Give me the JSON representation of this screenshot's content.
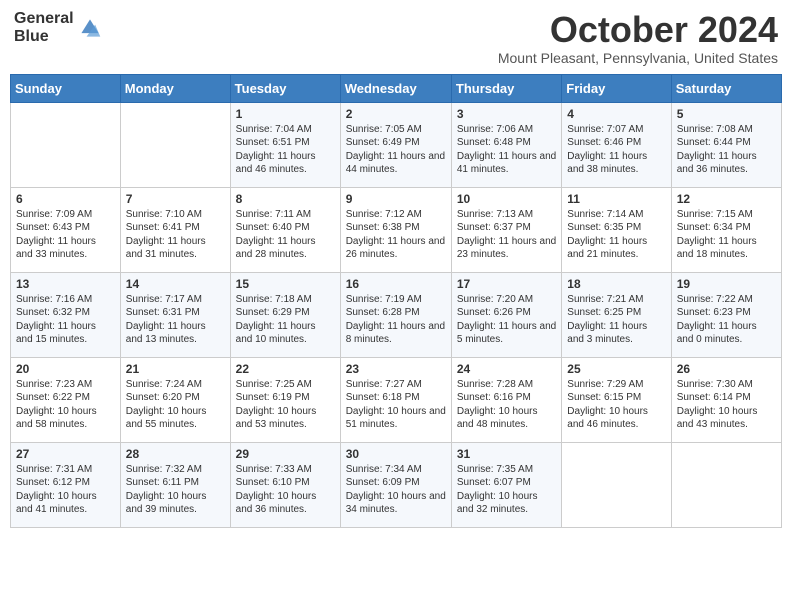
{
  "header": {
    "logo_line1": "General",
    "logo_line2": "Blue",
    "title": "October 2024",
    "subtitle": "Mount Pleasant, Pennsylvania, United States"
  },
  "weekdays": [
    "Sunday",
    "Monday",
    "Tuesday",
    "Wednesday",
    "Thursday",
    "Friday",
    "Saturday"
  ],
  "weeks": [
    [
      {
        "day": "",
        "content": ""
      },
      {
        "day": "",
        "content": ""
      },
      {
        "day": "1",
        "content": "Sunrise: 7:04 AM\nSunset: 6:51 PM\nDaylight: 11 hours and 46 minutes."
      },
      {
        "day": "2",
        "content": "Sunrise: 7:05 AM\nSunset: 6:49 PM\nDaylight: 11 hours and 44 minutes."
      },
      {
        "day": "3",
        "content": "Sunrise: 7:06 AM\nSunset: 6:48 PM\nDaylight: 11 hours and 41 minutes."
      },
      {
        "day": "4",
        "content": "Sunrise: 7:07 AM\nSunset: 6:46 PM\nDaylight: 11 hours and 38 minutes."
      },
      {
        "day": "5",
        "content": "Sunrise: 7:08 AM\nSunset: 6:44 PM\nDaylight: 11 hours and 36 minutes."
      }
    ],
    [
      {
        "day": "6",
        "content": "Sunrise: 7:09 AM\nSunset: 6:43 PM\nDaylight: 11 hours and 33 minutes."
      },
      {
        "day": "7",
        "content": "Sunrise: 7:10 AM\nSunset: 6:41 PM\nDaylight: 11 hours and 31 minutes."
      },
      {
        "day": "8",
        "content": "Sunrise: 7:11 AM\nSunset: 6:40 PM\nDaylight: 11 hours and 28 minutes."
      },
      {
        "day": "9",
        "content": "Sunrise: 7:12 AM\nSunset: 6:38 PM\nDaylight: 11 hours and 26 minutes."
      },
      {
        "day": "10",
        "content": "Sunrise: 7:13 AM\nSunset: 6:37 PM\nDaylight: 11 hours and 23 minutes."
      },
      {
        "day": "11",
        "content": "Sunrise: 7:14 AM\nSunset: 6:35 PM\nDaylight: 11 hours and 21 minutes."
      },
      {
        "day": "12",
        "content": "Sunrise: 7:15 AM\nSunset: 6:34 PM\nDaylight: 11 hours and 18 minutes."
      }
    ],
    [
      {
        "day": "13",
        "content": "Sunrise: 7:16 AM\nSunset: 6:32 PM\nDaylight: 11 hours and 15 minutes."
      },
      {
        "day": "14",
        "content": "Sunrise: 7:17 AM\nSunset: 6:31 PM\nDaylight: 11 hours and 13 minutes."
      },
      {
        "day": "15",
        "content": "Sunrise: 7:18 AM\nSunset: 6:29 PM\nDaylight: 11 hours and 10 minutes."
      },
      {
        "day": "16",
        "content": "Sunrise: 7:19 AM\nSunset: 6:28 PM\nDaylight: 11 hours and 8 minutes."
      },
      {
        "day": "17",
        "content": "Sunrise: 7:20 AM\nSunset: 6:26 PM\nDaylight: 11 hours and 5 minutes."
      },
      {
        "day": "18",
        "content": "Sunrise: 7:21 AM\nSunset: 6:25 PM\nDaylight: 11 hours and 3 minutes."
      },
      {
        "day": "19",
        "content": "Sunrise: 7:22 AM\nSunset: 6:23 PM\nDaylight: 11 hours and 0 minutes."
      }
    ],
    [
      {
        "day": "20",
        "content": "Sunrise: 7:23 AM\nSunset: 6:22 PM\nDaylight: 10 hours and 58 minutes."
      },
      {
        "day": "21",
        "content": "Sunrise: 7:24 AM\nSunset: 6:20 PM\nDaylight: 10 hours and 55 minutes."
      },
      {
        "day": "22",
        "content": "Sunrise: 7:25 AM\nSunset: 6:19 PM\nDaylight: 10 hours and 53 minutes."
      },
      {
        "day": "23",
        "content": "Sunrise: 7:27 AM\nSunset: 6:18 PM\nDaylight: 10 hours and 51 minutes."
      },
      {
        "day": "24",
        "content": "Sunrise: 7:28 AM\nSunset: 6:16 PM\nDaylight: 10 hours and 48 minutes."
      },
      {
        "day": "25",
        "content": "Sunrise: 7:29 AM\nSunset: 6:15 PM\nDaylight: 10 hours and 46 minutes."
      },
      {
        "day": "26",
        "content": "Sunrise: 7:30 AM\nSunset: 6:14 PM\nDaylight: 10 hours and 43 minutes."
      }
    ],
    [
      {
        "day": "27",
        "content": "Sunrise: 7:31 AM\nSunset: 6:12 PM\nDaylight: 10 hours and 41 minutes."
      },
      {
        "day": "28",
        "content": "Sunrise: 7:32 AM\nSunset: 6:11 PM\nDaylight: 10 hours and 39 minutes."
      },
      {
        "day": "29",
        "content": "Sunrise: 7:33 AM\nSunset: 6:10 PM\nDaylight: 10 hours and 36 minutes."
      },
      {
        "day": "30",
        "content": "Sunrise: 7:34 AM\nSunset: 6:09 PM\nDaylight: 10 hours and 34 minutes."
      },
      {
        "day": "31",
        "content": "Sunrise: 7:35 AM\nSunset: 6:07 PM\nDaylight: 10 hours and 32 minutes."
      },
      {
        "day": "",
        "content": ""
      },
      {
        "day": "",
        "content": ""
      }
    ]
  ]
}
